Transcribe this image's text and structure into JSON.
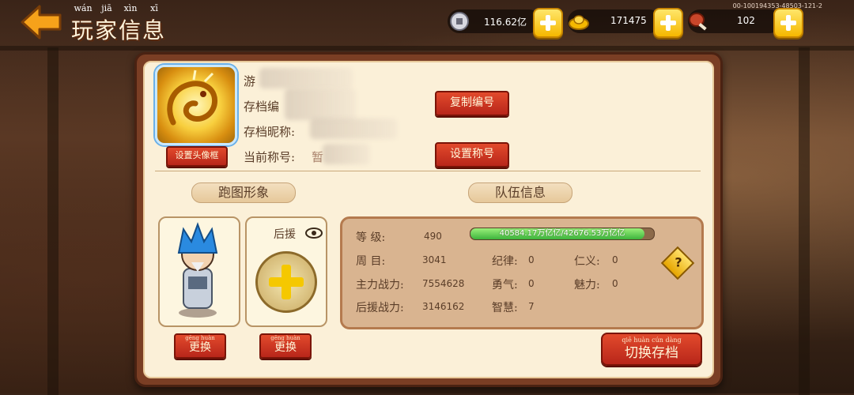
{
  "header": {
    "title_pinyin": [
      "wán",
      "jiā",
      "xìn",
      "xī"
    ],
    "title": "玩家信息",
    "build_code": "00-100194353-48503-121-2"
  },
  "resources": [
    {
      "name": "silver-coin-icon",
      "value": "116.62亿"
    },
    {
      "name": "gold-ingot-icon",
      "value": "171475"
    },
    {
      "name": "meat-icon",
      "value": "102"
    }
  ],
  "profile": {
    "label_game_id": "游",
    "label_save_no": "存档编",
    "label_save_nick": "存档昵称:",
    "label_current_title": "当前称号:",
    "current_title_partial": "暂",
    "btn_copy_id": "复制编号",
    "btn_set_title": "设置称号",
    "btn_set_frame": "设置头像框"
  },
  "sections": {
    "run_image": "跑图形象",
    "team_info": "队伍信息"
  },
  "support_label": "后援",
  "change_btn": "更换",
  "change_pinyin": "gēng huàn",
  "stats": {
    "level_label": "等    级:",
    "level_value": "490",
    "exp_text": "40584.17万亿亿/42676.53万亿亿",
    "exp_fraction": 0.95,
    "week_label": "周    目:",
    "week_value": "3041",
    "main_power_label": "主力战力:",
    "main_power_value": "7554628",
    "support_power_label": "后援战力:",
    "support_power_value": "3146162",
    "discipline_label": "纪律:",
    "discipline_value": "0",
    "courage_label": "勇气:",
    "courage_value": "0",
    "wisdom_label": "智慧:",
    "wisdom_value": "7",
    "benevolence_label": "仁义:",
    "benevolence_value": "0",
    "charm_label": "魅力:",
    "charm_value": "0",
    "help_mark": "?"
  },
  "switch_save_btn": "切换存档",
  "switch_save_pinyin": "qiē huàn cún dàng",
  "colors": {
    "accent_red": "#c22e1e",
    "gold": "#f5b800",
    "panel_bg": "#fbf0d8"
  }
}
